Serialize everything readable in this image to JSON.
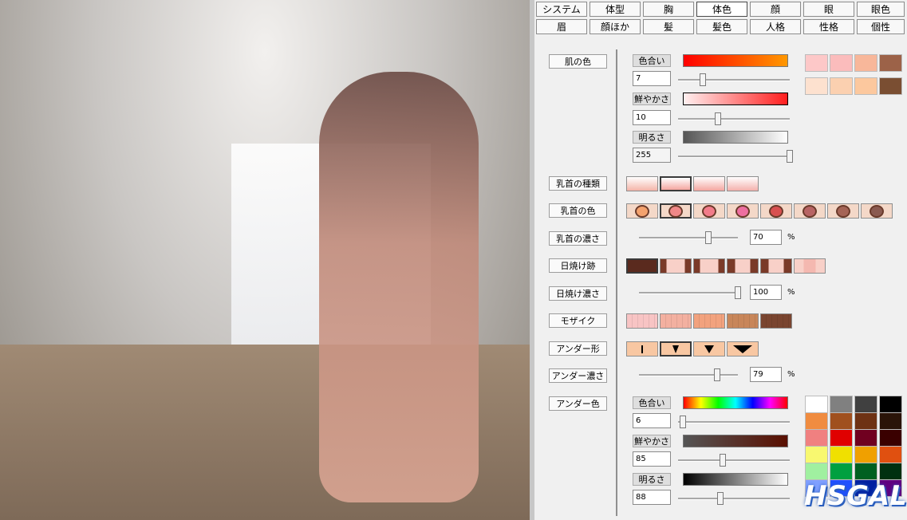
{
  "tabs_row1": [
    "システム",
    "体型",
    "胸",
    "体色",
    "顔",
    "眼",
    "眼色"
  ],
  "tabs_row2": [
    "眉",
    "顔ほか",
    "髪",
    "髪色",
    "人格",
    "性格",
    "個性"
  ],
  "active_tab": "体色",
  "labels": {
    "skin_color": "肌の色",
    "nipple_type": "乳首の種類",
    "nipple_color": "乳首の色",
    "nipple_depth": "乳首の濃さ",
    "tanline": "日焼け跡",
    "tan_depth": "日焼け濃さ",
    "mosaic": "モザイク",
    "under_shape": "アンダー形",
    "under_depth": "アンダー濃さ",
    "under_color": "アンダー色"
  },
  "skin": {
    "hue_label": "色合い",
    "hue_value": "7",
    "sat_label": "鮮やかさ",
    "sat_value": "10",
    "bri_label": "明るさ",
    "bri_value": "255",
    "hue_level": 0.22,
    "sat_level": 0.36,
    "bri_level": 1.0
  },
  "nipple_depth": {
    "value": "70",
    "unit": "%",
    "level": 0.7
  },
  "tan_depth": {
    "value": "100",
    "unit": "%",
    "level": 1.0
  },
  "under_depth": {
    "value": "79",
    "unit": "%",
    "level": 0.79
  },
  "under_color": {
    "hue_label": "色合い",
    "hue_value": "6",
    "sat_label": "鮮やかさ",
    "sat_value": "85",
    "bri_label": "明るさ",
    "bri_value": "88",
    "hue_level": 0.04,
    "sat_level": 0.4,
    "bri_level": 0.38
  },
  "skin_swatches": [
    "#fdc8c8",
    "#fbbcbc",
    "#f8b79a",
    "#9c6248",
    "#fde1cf",
    "#fbd0b0",
    "#fcc89e",
    "#7a4e32"
  ],
  "nipple_colors": [
    "#f4a26e",
    "#f08888",
    "#f27c8a",
    "#ee6fa0",
    "#d85050",
    "#b86464",
    "#a56456",
    "#8a5a50"
  ],
  "mosaic_colors": [
    "#f8c4c4",
    "#f3b0a0",
    "#f2a27e",
    "#c8865a",
    "#7a4530"
  ],
  "under_swatches": [
    "#ffffff",
    "#808080",
    "#404040",
    "#000000",
    "#f08c40",
    "#a0501e",
    "#6e3214",
    "#2a1408",
    "#f08080",
    "#e00000",
    "#700020",
    "#3a0000",
    "#f8f870",
    "#f0e000",
    "#f0a000",
    "#e05010",
    "#a0f0a0",
    "#00a040",
    "#006020",
    "#003010",
    "#80a0ff",
    "#2050ff",
    "#0020a0",
    "#600080"
  ],
  "logo_text": "HSGAL"
}
